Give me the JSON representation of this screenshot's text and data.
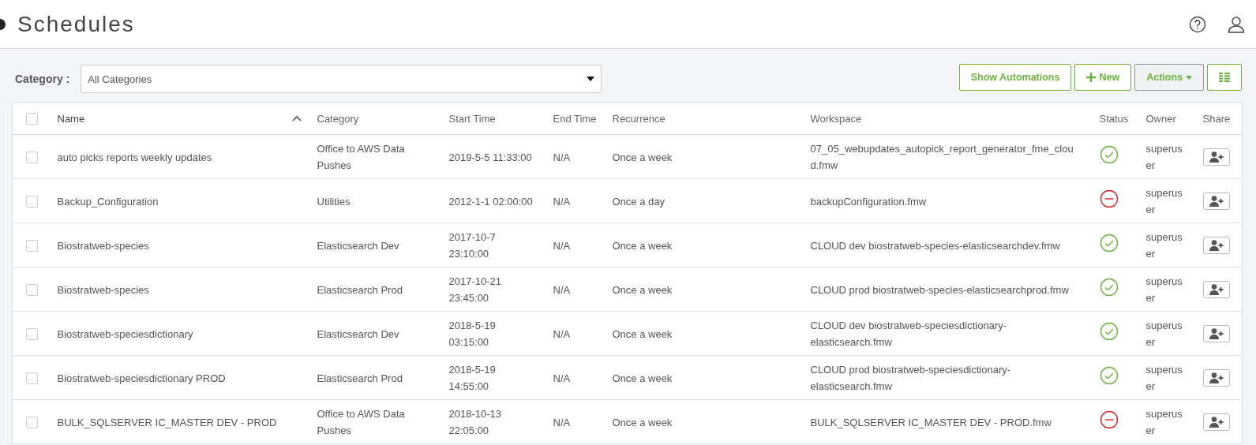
{
  "header": {
    "title": "Schedules"
  },
  "filter": {
    "label": "Category :",
    "value": "All Categories"
  },
  "toolbar": {
    "buttons": [
      {
        "label": "Show Automations",
        "kind": "text"
      },
      {
        "label": "New",
        "kind": "new"
      },
      {
        "label": "Actions",
        "kind": "dropdown"
      },
      {
        "kind": "columns"
      }
    ]
  },
  "table": {
    "select_all_checked": false,
    "columns": [
      {
        "label": "Name",
        "sorted": true
      },
      {
        "label": "Category",
        "sorted": false
      },
      {
        "label": "Start Time",
        "sorted": false
      },
      {
        "label": "End Time",
        "sorted": false
      },
      {
        "label": "Recurrence",
        "sorted": false
      },
      {
        "label": "Workspace",
        "sorted": false
      },
      {
        "label": "Status",
        "sorted": false
      },
      {
        "label": "Owner",
        "sorted": false
      },
      {
        "label": "Share",
        "sorted": false
      }
    ],
    "rows": [
      {
        "checked": false,
        "name": "auto picks reports weekly updates",
        "category": "Office to AWS Data Pushes",
        "start_time": "2019-5-5 11:33:00",
        "end_time": "N/A",
        "recurrence": "Once a week",
        "workspace": "07_05_webupdates_autopick_report_generator_fme_cloud.fmw",
        "enabled": true,
        "owner": "superuser"
      },
      {
        "checked": false,
        "name": "Backup_Configuration",
        "category": "Utilities",
        "start_time": "2012-1-1 02:00:00",
        "end_time": "N/A",
        "recurrence": "Once a day",
        "workspace": "backupConfiguration.fmw",
        "enabled": false,
        "owner": "superuser"
      },
      {
        "checked": false,
        "name": "Biostratweb-species",
        "category": "Elasticsearch Dev",
        "start_time": "2017-10-7 23:10:00",
        "end_time": "N/A",
        "recurrence": "Once a week",
        "workspace": "CLOUD dev biostratweb-species-elasticsearchdev.fmw",
        "enabled": true,
        "owner": "superuser"
      },
      {
        "checked": false,
        "name": "Biostratweb-species",
        "category": "Elasticsearch Prod",
        "start_time": "2017-10-21 23:45:00",
        "end_time": "N/A",
        "recurrence": "Once a week",
        "workspace": "CLOUD prod biostratweb-species-elasticsearchprod.fmw",
        "enabled": true,
        "owner": "superuser"
      },
      {
        "checked": false,
        "name": "Biostratweb-speciesdictionary",
        "category": "Elasticsearch Dev",
        "start_time": "2018-5-19 03:15:00",
        "end_time": "N/A",
        "recurrence": "Once a week",
        "workspace": "CLOUD dev biostratweb-speciesdictionary-elasticsearch.fmw",
        "enabled": true,
        "owner": "superuser"
      },
      {
        "checked": false,
        "name": "Biostratweb-speciesdictionary PROD",
        "category": "Elasticsearch Prod",
        "start_time": "2018-5-19 14:55:00",
        "end_time": "N/A",
        "recurrence": "Once a week",
        "workspace": "CLOUD prod biostratweb-speciesdictionary-elasticsearch.fmw",
        "enabled": true,
        "owner": "superuser"
      },
      {
        "checked": false,
        "name": "BULK_SQLSERVER IC_MASTER DEV - PROD",
        "category": "Office to AWS Data Pushes",
        "start_time": "2018-10-13 22:05:00",
        "end_time": "N/A",
        "recurrence": "Once a week",
        "workspace": "BULK_SQLSERVER IC_MASTER DEV - PROD.fmw",
        "enabled": false,
        "owner": "superuser"
      }
    ]
  }
}
